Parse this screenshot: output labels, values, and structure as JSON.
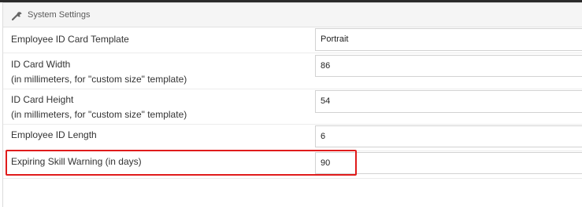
{
  "header": {
    "title": "System Settings",
    "icon": "wrench-icon"
  },
  "settings": [
    {
      "label": "Employee ID Card Template",
      "value": "Portrait"
    },
    {
      "label": "ID Card Width",
      "sublabel": "(in millimeters, for \"custom size\" template)",
      "value": "86"
    },
    {
      "label": "ID Card Height",
      "sublabel": "(in millimeters, for \"custom size\" template)",
      "value": "54"
    },
    {
      "label": "Employee ID Length",
      "value": "6"
    },
    {
      "label": "Expiring Skill Warning (in days)",
      "value": "90"
    }
  ],
  "colors": {
    "highlight": "#e01b1b",
    "topbar": "#2b2b2b"
  }
}
